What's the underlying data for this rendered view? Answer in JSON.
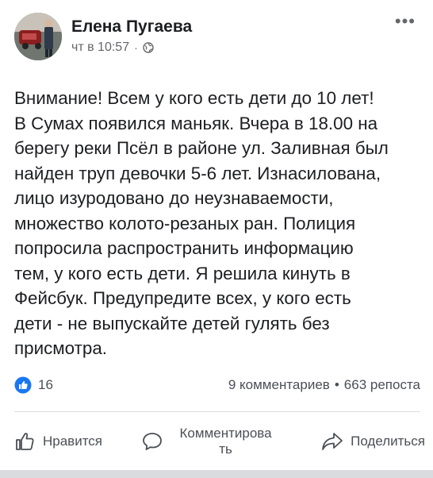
{
  "post": {
    "author": "Елена Пугаева",
    "time": "чт в 10:57",
    "separator": "·",
    "more_label": "•••",
    "text": "Внимание! Всем у кого есть дети до 10 лет!\nВ Сумах появился маньяк. Вчера в 18.00 на\nберегу реки Псёл в районе ул. Заливная был\nнайден труп девочки 5-6 лет. Изнасилована,\nлицо изуродовано до неузнаваемости,\nмножество колото-резаных ран. Полиция\nпопросила распространить информацию\nтем, у кого есть дети. Я решила кинуть в\nФейсбук. Предупредите всех, у кого есть\nдети - не выпускайте детей гулять без\nприсмотра."
  },
  "stats": {
    "likes": "16",
    "comments": "9 комментариев",
    "separator": "•",
    "shares": "663 репоста"
  },
  "actions": {
    "like_label": "Нравится",
    "comment_label_line1": "Комментирова",
    "comment_label_line2": "ть",
    "share_label": "Поделиться"
  },
  "colors": {
    "text": "#1c1e21",
    "secondary": "#65676b",
    "like_blue": "#1877f2",
    "divider": "#dadde1"
  },
  "icons": {
    "privacy": "globe-icon",
    "more": "more-icon",
    "like_badge": "thumbs-up-icon",
    "like": "thumbs-up-outline-icon",
    "comment": "comment-icon",
    "share": "share-icon"
  }
}
